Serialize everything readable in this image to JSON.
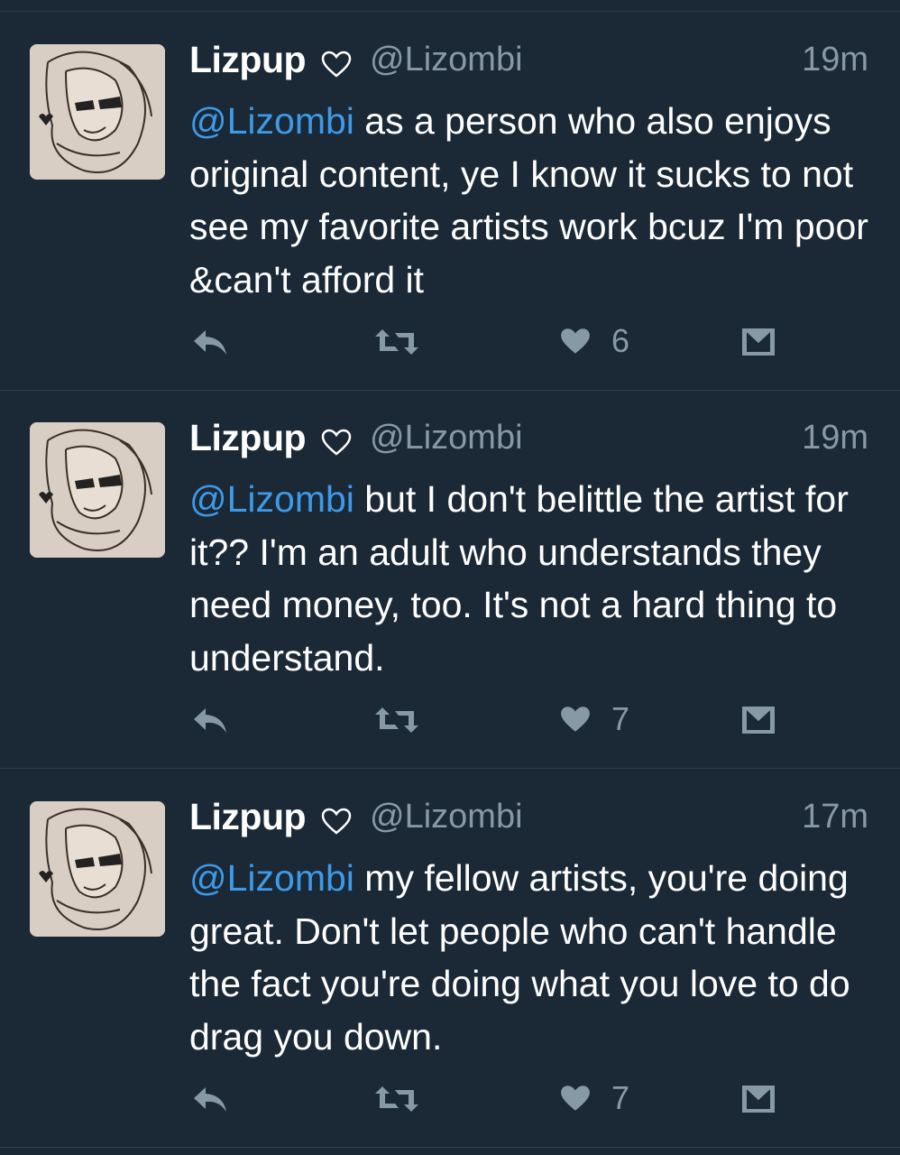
{
  "tweets": [
    {
      "name": "Lizpup",
      "handle": "@Lizombi",
      "time": "19m",
      "mention": "@Lizombi",
      "body": " as a person who also enjoys original content, ye I know it sucks to not see my favorite artists work bcuz I'm poor &can't afford it",
      "likes": "6"
    },
    {
      "name": "Lizpup",
      "handle": "@Lizombi",
      "time": "19m",
      "mention": "@Lizombi",
      "body": " but I don't belittle the artist for it?? I'm an adult who understands they need money, too. It's not a hard thing to understand.",
      "likes": "7"
    },
    {
      "name": "Lizpup",
      "handle": "@Lizombi",
      "time": "17m",
      "mention": "@Lizombi",
      "body": " my fellow artists, you're doing great. Don't let people who can't handle the fact you're doing what you love to do drag you down.",
      "likes": "7"
    }
  ],
  "icons": {
    "reply": "reply-arrow-icon",
    "retweet": "retweet-icon",
    "like": "heart-icon",
    "dm": "envelope-icon",
    "name_badge": "heart-outline-icon"
  },
  "colors": {
    "background": "#1b2836",
    "mention": "#3d9ae8",
    "muted": "#8899a6",
    "icon": "#8899a6"
  }
}
